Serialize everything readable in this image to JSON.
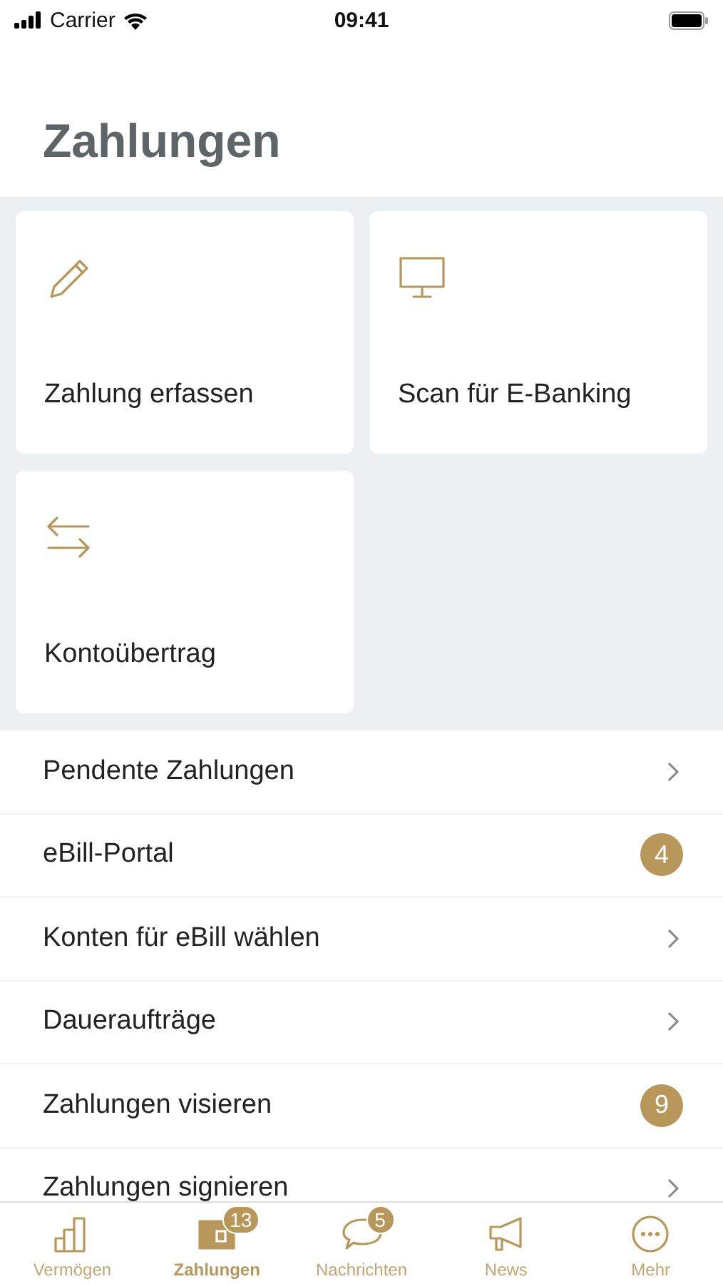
{
  "status_bar": {
    "carrier": "Carrier",
    "time": "09:41"
  },
  "title": "Zahlungen",
  "tiles": [
    {
      "label": "Zahlung erfassen"
    },
    {
      "label": "Scan für E-Banking"
    },
    {
      "label": "Kontoübertrag"
    }
  ],
  "menu": [
    {
      "label": "Pendente Zahlungen",
      "kind": "chevron"
    },
    {
      "label": "eBill-Portal",
      "kind": "badge",
      "badge": "4"
    },
    {
      "label": "Konten für eBill wählen",
      "kind": "chevron"
    },
    {
      "label": "Daueraufträge",
      "kind": "chevron"
    },
    {
      "label": "Zahlungen visieren",
      "kind": "badge",
      "badge": "9"
    },
    {
      "label": "Zahlungen signieren",
      "kind": "chevron"
    }
  ],
  "tab_bar": [
    {
      "label": "Vermögen",
      "selected": false
    },
    {
      "label": "Zahlungen",
      "selected": true,
      "badge": "13"
    },
    {
      "label": "Nachrichten",
      "selected": false,
      "badge": "5"
    },
    {
      "label": "News",
      "selected": false
    },
    {
      "label": "Mehr",
      "selected": false
    }
  ]
}
